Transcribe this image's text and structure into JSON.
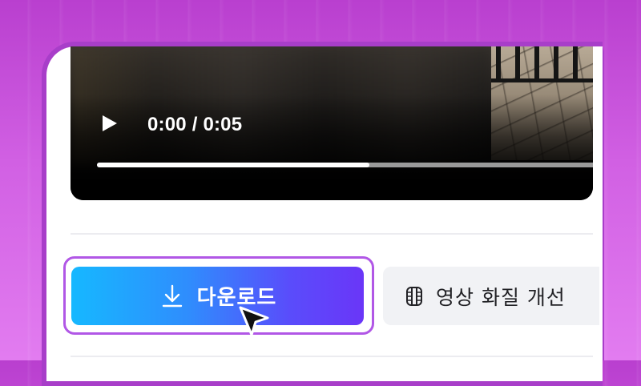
{
  "player": {
    "time_display": "0:00 / 0:05",
    "progress": 0.55,
    "play_icon": "play-icon"
  },
  "actions": {
    "download_label": "다운로드",
    "download_icon": "download-icon",
    "enhance_label": "영상 화질 개선",
    "enhance_icon": "film-icon"
  },
  "colors": {
    "background": "#c54bd9",
    "card_border": "#a83ec9",
    "button_gradient_start": "#16b8ff",
    "button_gradient_end": "#6a36f8",
    "highlight": "#b157e6",
    "secondary_button": "#f1f2f5"
  }
}
